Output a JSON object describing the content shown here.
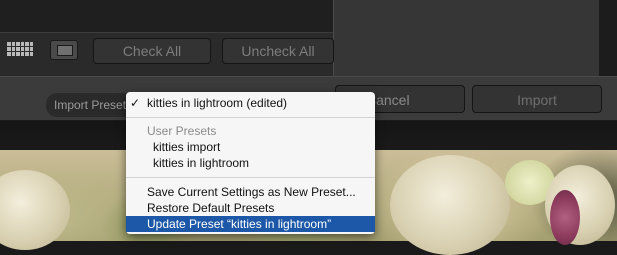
{
  "toolbar": {
    "check_all_label": "Check All",
    "uncheck_all_label": "Uncheck All"
  },
  "bottom_bar": {
    "import_preset_label": "Import Preset",
    "cancel_label": "Cancel",
    "import_label": "Import"
  },
  "preset_menu": {
    "current_item": {
      "check": "✓",
      "label": "kitties in lightroom (edited)"
    },
    "user_presets_header": "User Presets",
    "user_presets": [
      "kitties import",
      "kitties in lightroom"
    ],
    "actions": {
      "save_current": "Save Current Settings as New Preset...",
      "restore_default": "Restore Default Presets",
      "update_preset": "Update Preset “kitties in lightroom”"
    }
  }
}
